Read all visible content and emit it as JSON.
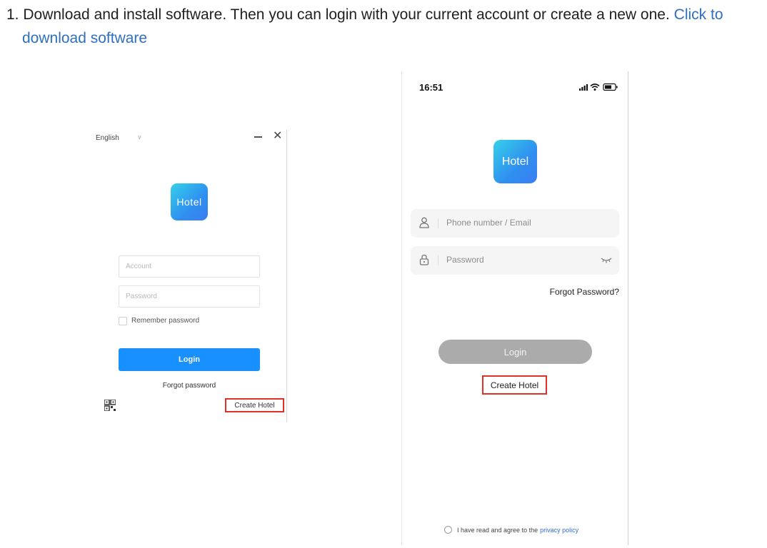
{
  "instruction": {
    "text": "1. Download and install software. Then you can login with your current account or create a new one.",
    "link_part1": "Click to",
    "link_part2": "download software"
  },
  "desktop": {
    "language": "English",
    "logo_text": "Hotel",
    "account_placeholder": "Account",
    "password_placeholder": "Password",
    "remember_label": "Remember password",
    "login_label": "Login",
    "forgot_label": "Forgot password",
    "create_hotel_label": "Create Hotel",
    "colors": {
      "primary": "#1890ff",
      "highlight": "#e0302a"
    }
  },
  "mobile": {
    "time": "16:51",
    "logo_text": "Hotel",
    "phone_placeholder": "Phone number / Email",
    "password_placeholder": "Password",
    "forgot_label": "Forgot Password?",
    "login_label": "Login",
    "create_hotel_label": "Create Hotel",
    "agree_text": "I have read and agree to the",
    "privacy_link": "privacy policy",
    "colors": {
      "login_disabled": "#ababab",
      "link": "#2f6fd6",
      "highlight": "#e0302a"
    }
  }
}
